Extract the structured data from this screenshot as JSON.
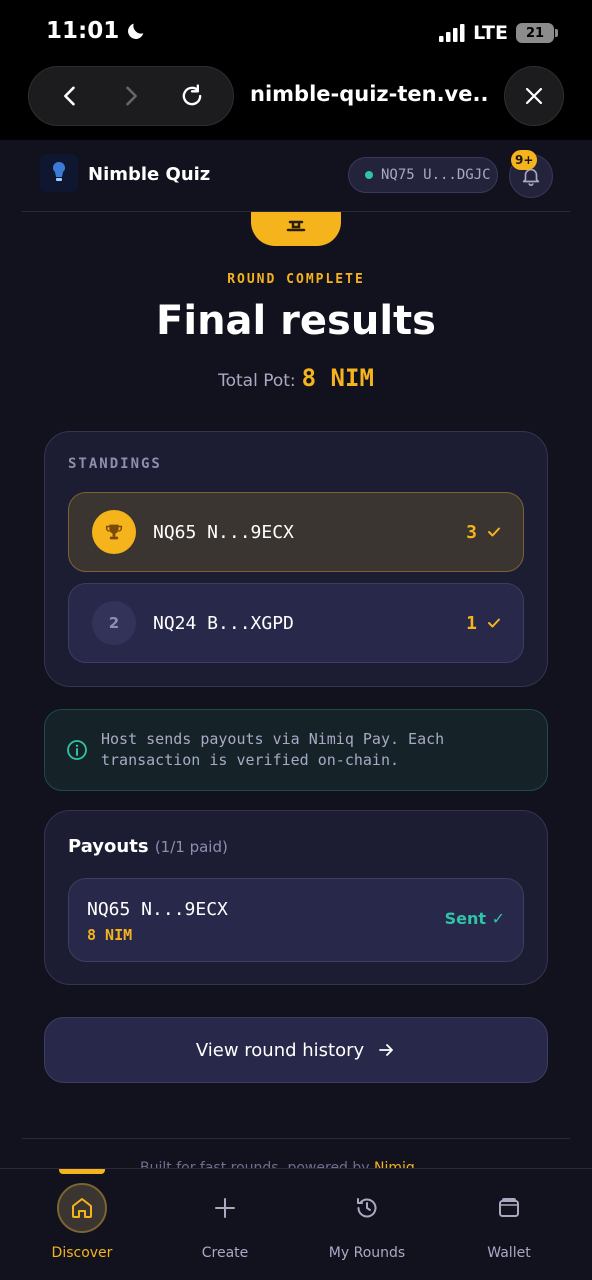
{
  "status_bar": {
    "time": "11:01",
    "network": "LTE",
    "battery": "21"
  },
  "browser": {
    "url": "nimble-quiz-ten.ve..."
  },
  "header": {
    "app_name": "Nimble Quiz",
    "wallet_address": "NQ75 U...DGJC",
    "notification_count": "9+"
  },
  "hero": {
    "eyebrow": "ROUND COMPLETE",
    "title": "Final results",
    "pot_label": "Total Pot:",
    "pot_value": "8 NIM"
  },
  "standings": {
    "heading": "STANDINGS",
    "rows": [
      {
        "rank": "1",
        "player": "NQ65 N...9ECX",
        "score": "3"
      },
      {
        "rank": "2",
        "player": "NQ24 B...XGPD",
        "score": "1"
      }
    ]
  },
  "info": {
    "text": "Host sends payouts via Nimiq Pay. Each transaction is verified on-chain."
  },
  "payouts": {
    "title": "Payouts",
    "count": "(1/1 paid)",
    "rows": [
      {
        "player": "NQ65 N...9ECX",
        "amount": "8 NIM",
        "status": "Sent ✓"
      }
    ]
  },
  "history_button": {
    "label": "View round history"
  },
  "footer": {
    "text": "Built for fast rounds, powered by ",
    "link": "Nimiq"
  },
  "bottom_nav": {
    "items": [
      {
        "label": "Discover",
        "icon": "home-icon",
        "active": true
      },
      {
        "label": "Create",
        "icon": "plus-icon",
        "active": false
      },
      {
        "label": "My Rounds",
        "icon": "history-icon",
        "active": false
      },
      {
        "label": "Wallet",
        "icon": "wallet-icon",
        "active": false
      }
    ]
  },
  "colors": {
    "accent": "#f5b31c",
    "success": "#2ec4a6",
    "background": "#12121f",
    "card": "#1c1c33"
  }
}
